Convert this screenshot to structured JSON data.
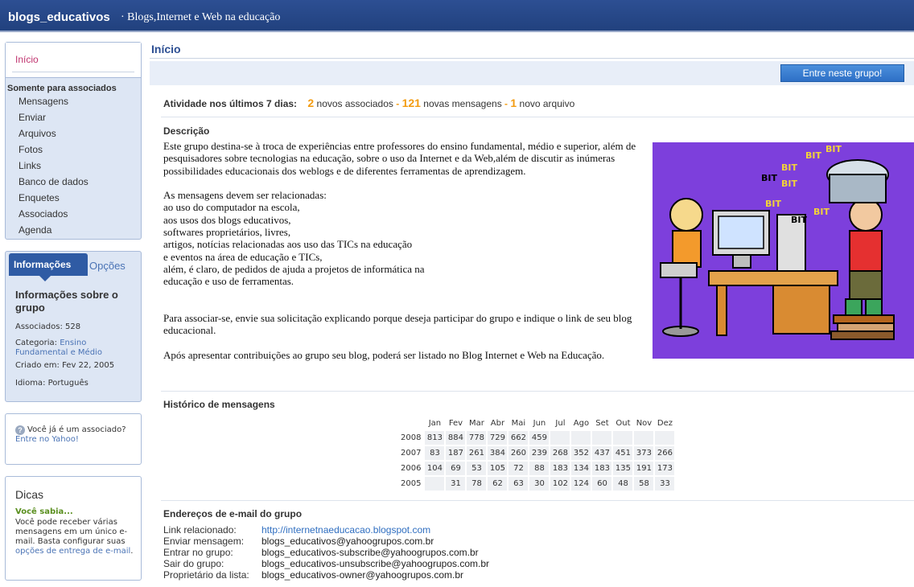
{
  "header": {
    "group_name": "blogs_educativos",
    "group_desc": "· Blogs,Internet e Web na educação"
  },
  "sidebar": {
    "home": "Início",
    "members_only": "Somente para associados",
    "items": [
      "Mensagens",
      "Enviar",
      "Arquivos",
      "Fotos",
      "Links",
      "Banco de dados",
      "Enquetes",
      "Associados",
      "Agenda"
    ]
  },
  "info": {
    "tab_active": "Informações",
    "tab_other": "Opções",
    "title": "Informações sobre o grupo",
    "members": "Associados: 528",
    "category_label": "Categoria: ",
    "category_value": "Ensino Fundamental e Médio",
    "created": "Criado em: Fev 22, 2005",
    "language": "Idioma: Português"
  },
  "member_box": {
    "icon": "question-icon",
    "text": "Você já é um associado? ",
    "link": "Entre no Yahoo!"
  },
  "tips": {
    "title": "Dicas",
    "subtitle": "Você sabia...",
    "text": "Você pode receber várias mensagens em um único e-mail. Basta configurar suas ",
    "link": "opções de entrega de e-mail",
    "end": "."
  },
  "main": {
    "page_title": "Início",
    "join_button": "Entre neste grupo!",
    "activity_label": "Atividade nos últimos 7 dias:",
    "activity": {
      "new_members_count": "2",
      "new_members_label": "novos associados",
      "new_messages_count": "121",
      "new_messages_label": "novas mensagens",
      "new_files_count": "1",
      "new_files_label": "novo arquivo",
      "sep": "-"
    },
    "description_title": "Descrição",
    "description": "Este grupo destina-se à troca de experiências entre professores do ensino fundamental, médio e superior, além de pesquisadores sobre tecnologias na educação, sobre o uso da Internet e da Web,além de discutir as inúmeras possibilidades educacionais dos weblogs e de diferentes ferramentas de aprendizagem.\n\nAs mensagens devem ser relacionadas:\nao uso do computador na escola,\naos usos dos blogs educativos,\nsoftwares proprietários, livres,\nartigos, notícias relacionadas aos uso das TICs na educação\ne eventos na área de educação e TICs,\nalém, é claro, de pedidos de ajuda a projetos de informática na\neducação e uso de ferramentas.\n\n\nPara associar-se, envie sua solicitação explicando porque deseja participar do grupo e indique o link de seu blog educacional.\n\nApós apresentar contribuições ao grupo seu blog, poderá ser listado no Blog Internet e Web na Educação.",
    "image_words": [
      "BIT",
      "BIT",
      "BIT",
      "BIT",
      "BIT",
      "BIT",
      "BIT",
      "BIT"
    ],
    "history_title": "Histórico de mensagens",
    "history": {
      "months": [
        "Jan",
        "Fev",
        "Mar",
        "Abr",
        "Mai",
        "Jun",
        "Jul",
        "Ago",
        "Set",
        "Out",
        "Nov",
        "Dez"
      ],
      "rows": [
        {
          "year": "2008",
          "values": [
            "813",
            "884",
            "778",
            "729",
            "662",
            "459",
            "",
            "",
            "",
            "",
            "",
            ""
          ]
        },
        {
          "year": "2007",
          "values": [
            "83",
            "187",
            "261",
            "384",
            "260",
            "239",
            "268",
            "352",
            "437",
            "451",
            "373",
            "266"
          ]
        },
        {
          "year": "2006",
          "values": [
            "104",
            "69",
            "53",
            "105",
            "72",
            "88",
            "183",
            "134",
            "183",
            "135",
            "191",
            "173"
          ]
        },
        {
          "year": "2005",
          "values": [
            "",
            "31",
            "78",
            "62",
            "63",
            "30",
            "102",
            "124",
            "60",
            "48",
            "58",
            "33"
          ]
        }
      ]
    },
    "emails_title": "Endereços de e-mail do grupo",
    "emails": [
      {
        "label": "Link relacionado:",
        "value": "http://internetnaeducacao.blogspot.com"
      },
      {
        "label": "Enviar mensagem:",
        "value": "blogs_educativos@yahoogrupos.com.br"
      },
      {
        "label": "Entrar no grupo:",
        "value": "blogs_educativos-subscribe@yahoogrupos.com.br"
      },
      {
        "label": "Sair do grupo:",
        "value": "blogs_educativos-unsubscribe@yahoogrupos.com.br"
      },
      {
        "label": "Proprietário da lista:",
        "value": "blogs_educativos-owner@yahoogrupos.com.br"
      }
    ]
  }
}
